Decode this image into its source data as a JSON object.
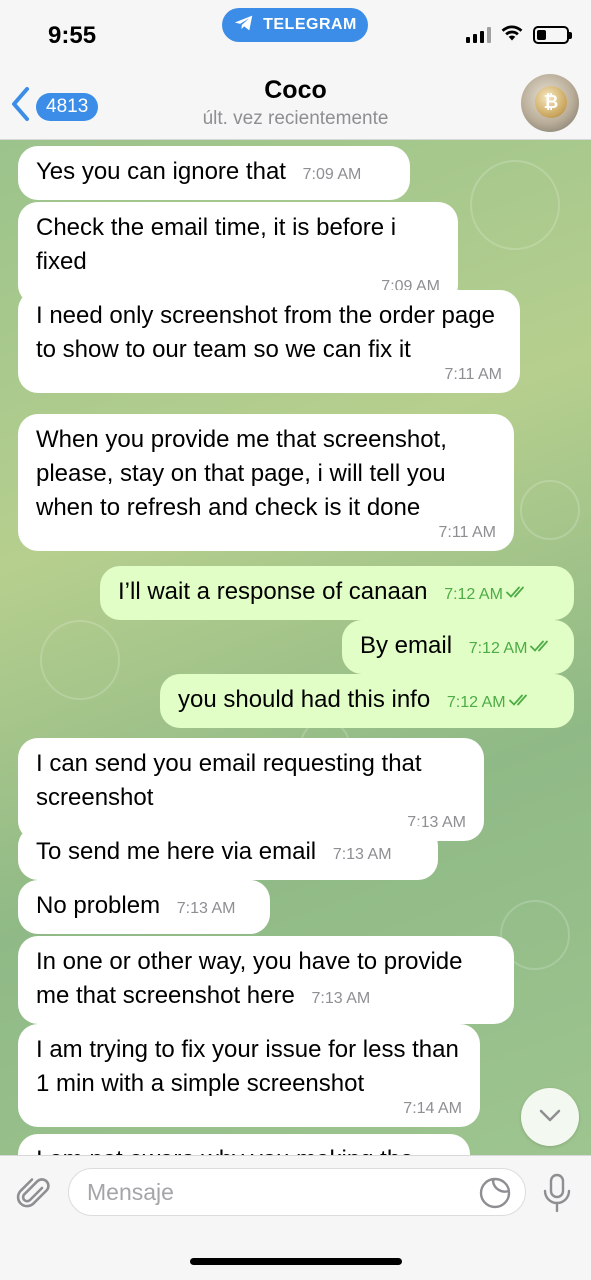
{
  "status_bar": {
    "time": "9:55",
    "app_pill": "TELEGRAM"
  },
  "header": {
    "back_count": "4813",
    "title": "Coco",
    "subtitle": "últ. vez recientemente"
  },
  "colors": {
    "accent": "#3b8de8",
    "incoming_bubble": "#ffffff",
    "outgoing_bubble": "#e1fec6",
    "read_check": "#4dac45"
  },
  "messages": [
    {
      "dir": "in",
      "text": "Yes you can ignore that",
      "time": "7:09 AM"
    },
    {
      "dir": "in",
      "text": "Check the email time, it is before i fixed",
      "time": "7:09 AM"
    },
    {
      "dir": "in",
      "text": "I need only screenshot from the order page to show to our team so we can fix it",
      "time": "7:11 AM"
    },
    {
      "dir": "in",
      "text": "When you provide me that screenshot, please, stay on that page, i will tell you when to refresh and check is it done",
      "time": "7:11 AM"
    },
    {
      "dir": "out",
      "text": "I’ll wait a response of canaan",
      "time": "7:12 AM"
    },
    {
      "dir": "out",
      "text": "By email",
      "time": "7:12 AM"
    },
    {
      "dir": "out",
      "text": "you should had this info",
      "time": "7:12 AM"
    },
    {
      "dir": "in",
      "text": "I can send you email requesting that screenshot",
      "time": "7:13 AM"
    },
    {
      "dir": "in",
      "text": "To send me here via email",
      "time": "7:13 AM"
    },
    {
      "dir": "in",
      "text": "No problem",
      "time": "7:13 AM"
    },
    {
      "dir": "in",
      "text": "In one or other way, you have to provide me that screenshot here",
      "time": "7:13 AM"
    },
    {
      "dir": "in",
      "text": "I am trying to fix your issue for less than 1 min with a simple screenshot",
      "time": "7:14 AM"
    },
    {
      "dir": "in",
      "text": "I am not aware why you making the",
      "time": ""
    }
  ],
  "composer": {
    "placeholder": "Mensaje"
  },
  "icons": {
    "back": "chevron-left-icon",
    "attach": "paperclip-icon",
    "sticker": "sticker-icon",
    "mic": "microphone-icon",
    "scroll_down": "chevron-down-icon",
    "telegram": "telegram-plane-icon",
    "read": "double-check-icon"
  }
}
